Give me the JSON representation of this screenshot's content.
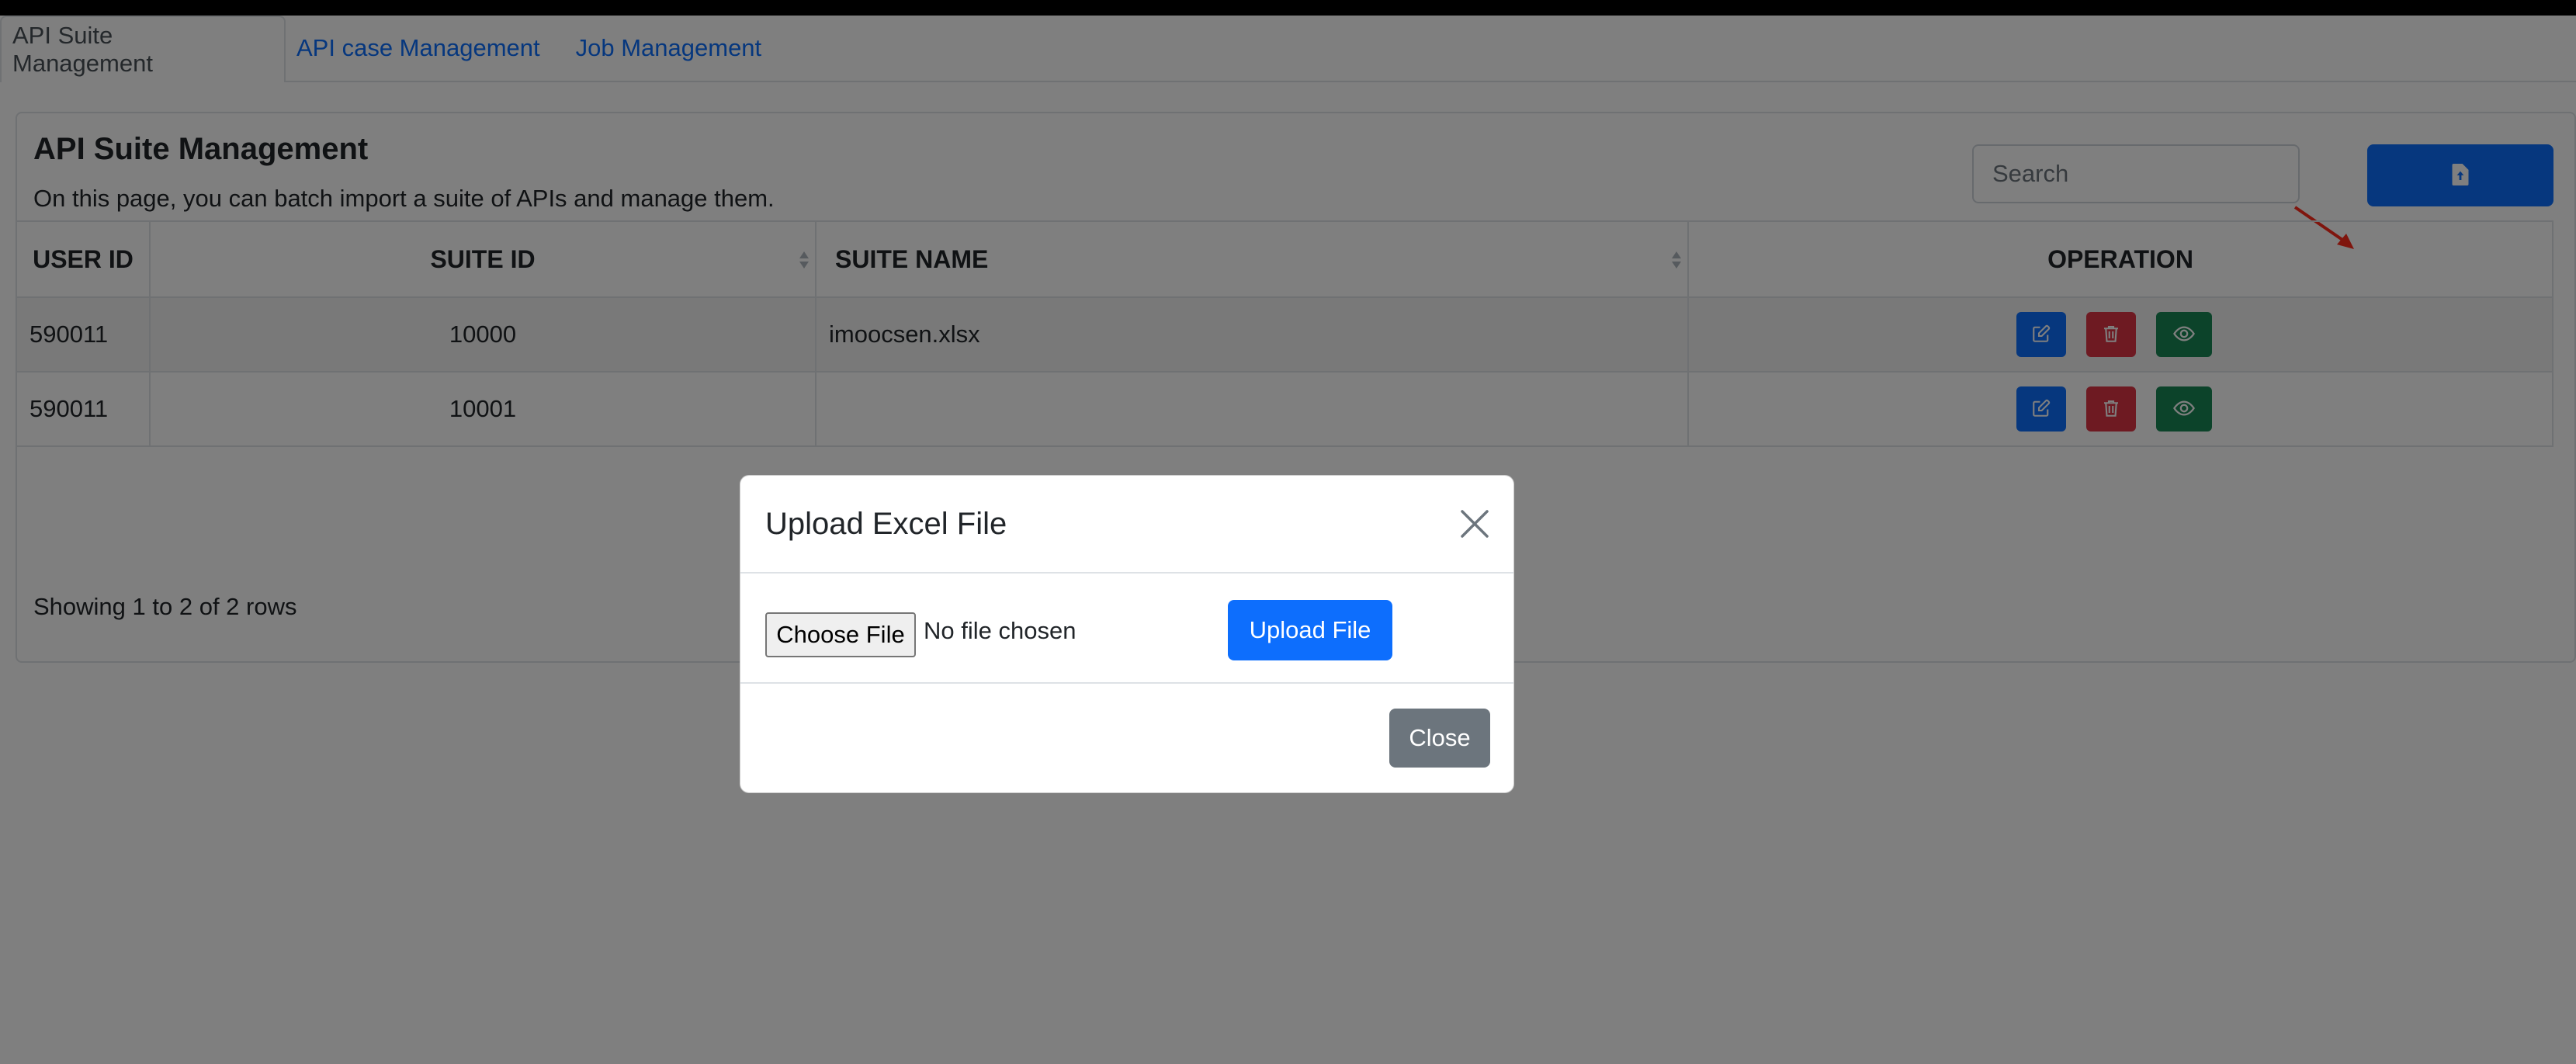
{
  "tabs": [
    {
      "label": "API Suite Management"
    },
    {
      "label": "API case Management"
    },
    {
      "label": "Job Management"
    }
  ],
  "card": {
    "title": "API Suite Management",
    "description": "On this page, you can batch import a suite of APIs and manage them."
  },
  "search": {
    "placeholder": "Search"
  },
  "table": {
    "headers": [
      "USER ID",
      "SUITE ID",
      "SUITE NAME",
      "OPERATION"
    ],
    "rows": [
      {
        "user_id": "590011",
        "suite_id": "10000",
        "suite_name": "imoocsen.xlsx"
      },
      {
        "user_id": "590011",
        "suite_id": "10001",
        "suite_name": ""
      }
    ]
  },
  "footer": {
    "info": "Showing 1 to 2 of 2 rows"
  },
  "modal": {
    "title": "Upload Excel File",
    "choose_label": "Choose File",
    "no_file_label": "No file chosen",
    "upload_label": "Upload File",
    "close_label": "Close"
  },
  "colors": {
    "primary": "#0d6efd",
    "danger": "#dc3545",
    "success": "#198754",
    "secondary": "#6c757d",
    "annotation": "#ff2a1a"
  },
  "icons": {
    "upload": "file-upload-icon",
    "edit": "edit-icon",
    "delete": "trash-icon",
    "view": "eye-icon",
    "close": "close-icon"
  }
}
